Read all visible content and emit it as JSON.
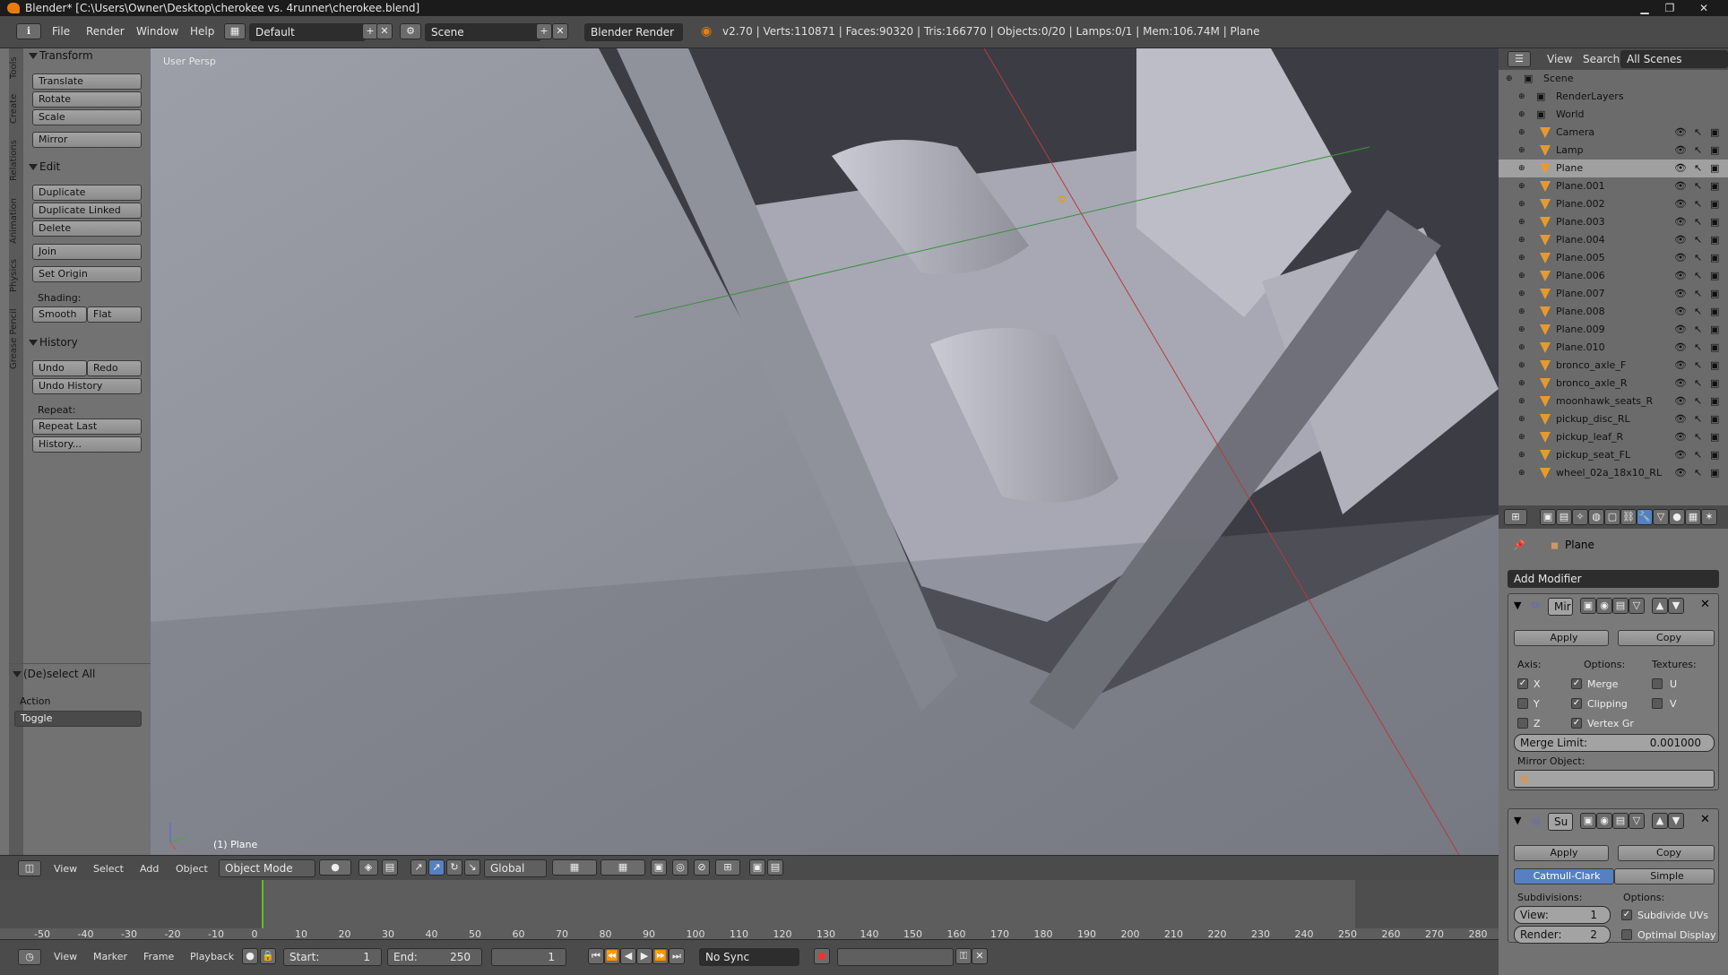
{
  "title": "Blender* [C:\\Users\\Owner\\Desktop\\cherokee vs. 4runner\\cherokee.blend]",
  "menus": [
    "File",
    "Render",
    "Window",
    "Help"
  ],
  "layout": "Default",
  "scene": "Scene",
  "engine": "Blender Render",
  "stats": "v2.70 | Verts:110871 | Faces:90320 | Tris:166770 | Objects:0/20 | Lamps:0/1 | Mem:106.74M | Plane",
  "side_tabs": [
    "Tools",
    "Create",
    "Relations",
    "Animation",
    "Physics",
    "Grease Pencil"
  ],
  "tools": {
    "transform_hdr": "Transform",
    "translate": "Translate",
    "rotate": "Rotate",
    "scale": "Scale",
    "mirror": "Mirror",
    "edit_hdr": "Edit",
    "duplicate": "Duplicate",
    "duplicate_linked": "Duplicate Linked",
    "delete": "Delete",
    "join": "Join",
    "set_origin": "Set Origin",
    "shading": "Shading:",
    "smooth": "Smooth",
    "flat": "Flat",
    "history_hdr": "History",
    "undo": "Undo",
    "redo": "Redo",
    "undo_history": "Undo History",
    "repeat": "Repeat:",
    "repeat_last": "Repeat Last",
    "history": "History..."
  },
  "operator": {
    "hdr": "(De)select All",
    "action_label": "Action",
    "action_value": "Toggle"
  },
  "viewport": {
    "persp": "User Persp",
    "object": "(1) Plane"
  },
  "vheader": {
    "menus": [
      "View",
      "Select",
      "Add",
      "Object"
    ],
    "mode": "Object Mode",
    "orientation": "Global"
  },
  "timeline": {
    "ticks": [
      "-50",
      "-40",
      "-30",
      "-20",
      "-10",
      "0",
      "10",
      "20",
      "30",
      "40",
      "50",
      "60",
      "70",
      "80",
      "90",
      "100",
      "110",
      "120",
      "130",
      "140",
      "150",
      "160",
      "170",
      "180",
      "190",
      "200",
      "210",
      "220",
      "230",
      "240",
      "250",
      "260",
      "270",
      "280"
    ],
    "menus": [
      "View",
      "Marker",
      "Frame",
      "Playback"
    ],
    "start": "Start:",
    "start_val": "1",
    "end": "End:",
    "end_val": "250",
    "current": "1",
    "sync": "No Sync"
  },
  "outliner": {
    "view": "View",
    "search": "Search",
    "scope": "All Scenes",
    "rows": [
      "Scene",
      "RenderLayers",
      "World",
      "Camera",
      "Lamp",
      "Plane",
      "Plane.001",
      "Plane.002",
      "Plane.003",
      "Plane.004",
      "Plane.005",
      "Plane.006",
      "Plane.007",
      "Plane.008",
      "Plane.009",
      "Plane.010",
      "bronco_axle_F",
      "bronco_axle_R",
      "moonhawk_seats_R",
      "pickup_disc_RL",
      "pickup_leaf_R",
      "pickup_seat_FL",
      "wheel_02a_18x10_RL"
    ]
  },
  "properties": {
    "object": "Plane",
    "add_modifier": "Add Modifier",
    "mirror": {
      "name": "Mir",
      "apply": "Apply",
      "copy": "Copy",
      "axis": "Axis:",
      "options": "Options:",
      "textures": "Textures:",
      "x": "X",
      "y": "Y",
      "z": "Z",
      "merge": "Merge",
      "clipping": "Clipping",
      "vertex": "Vertex Gr",
      "u": "U",
      "v": "V",
      "merge_limit": "Merge Limit:",
      "merge_val": "0.001000",
      "mirror_obj": "Mirror Object:"
    },
    "subsurf": {
      "name": "Su",
      "apply": "Apply",
      "copy": "Copy",
      "catmull": "Catmull-Clark",
      "simple": "Simple",
      "subdivisions": "Subdivisions:",
      "options": "Options:",
      "view": "View:",
      "view_val": "1",
      "render": "Render:",
      "render_val": "2",
      "subdivide_uvs": "Subdivide UVs",
      "optimal": "Optimal Display"
    }
  }
}
